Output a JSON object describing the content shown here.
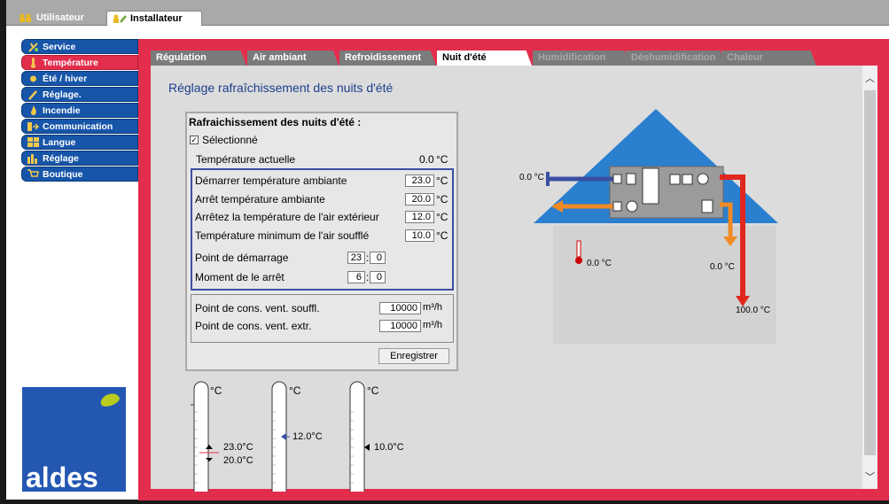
{
  "top_tabs": [
    {
      "label": "Utilisateur"
    },
    {
      "label": "Installateur"
    }
  ],
  "sidebar": {
    "items": [
      {
        "label": "Service"
      },
      {
        "label": "Température"
      },
      {
        "label": "Été / hiver"
      },
      {
        "label": "Réglage."
      },
      {
        "label": "Incendie"
      },
      {
        "label": "Communication"
      },
      {
        "label": "Langue"
      },
      {
        "label": "Réglage"
      },
      {
        "label": "Boutique"
      }
    ],
    "active_index": 1
  },
  "logo": {
    "text": "aldes"
  },
  "sub_tabs": [
    {
      "label": "Régulation"
    },
    {
      "label": "Air ambiant"
    },
    {
      "label": "Refroidissement"
    },
    {
      "label": "Nuit d'été"
    },
    {
      "label": "Humidification"
    },
    {
      "label": "Déshumidification"
    },
    {
      "label": "Chaleur"
    }
  ],
  "page_title": "Réglage rafraîchissement des nuits d'été",
  "panel": {
    "title": "Rafraichissement des nuits d'été :",
    "selected_label": "Sélectionné",
    "selected_check": "✓",
    "current_temp_label": "Température actuelle",
    "current_temp_value": "0.0",
    "unit_c": "°C",
    "rows": [
      {
        "label": "Démarrer température ambiante",
        "value": "23.0"
      },
      {
        "label": "Arrêt température ambiante",
        "value": "20.0"
      },
      {
        "label": "Arrêtez la température de l'air extérieur",
        "value": "12.0"
      },
      {
        "label": "Température minimum de l'air soufflé",
        "value": "10.0"
      }
    ],
    "start_label": "Point de démarrage",
    "start_h": "23",
    "start_m": "0",
    "stop_label": "Moment de le arrêt",
    "stop_h": "6",
    "stop_m": "0",
    "colon": ":",
    "supply_label": "Point de cons. vent. souffl.",
    "supply_value": "10000",
    "extract_label": "Point de cons. vent. extr.",
    "extract_value": "10000",
    "unit_flow": "m³/h",
    "save_label": "Enregistrer"
  },
  "thermometers": [
    {
      "unit": "°C",
      "markers": [
        "23.0°C",
        "20.0°C"
      ]
    },
    {
      "unit": "°C",
      "markers": [
        "12.0°C"
      ]
    },
    {
      "unit": "°C",
      "markers": [
        "10.0°C"
      ]
    }
  ],
  "diagram": {
    "outside_air": "0.0 °C",
    "room_temp": "0.0 °C",
    "supply_temp": "0.0 °C",
    "exhaust_temp": "100.0 °C"
  },
  "colors": {
    "accent_red": "#e32d4c",
    "nav_blue": "#1655a8",
    "roof_blue": "#2a7fcf",
    "supply_orange": "#f08a24",
    "extract_red": "#e0281e"
  }
}
